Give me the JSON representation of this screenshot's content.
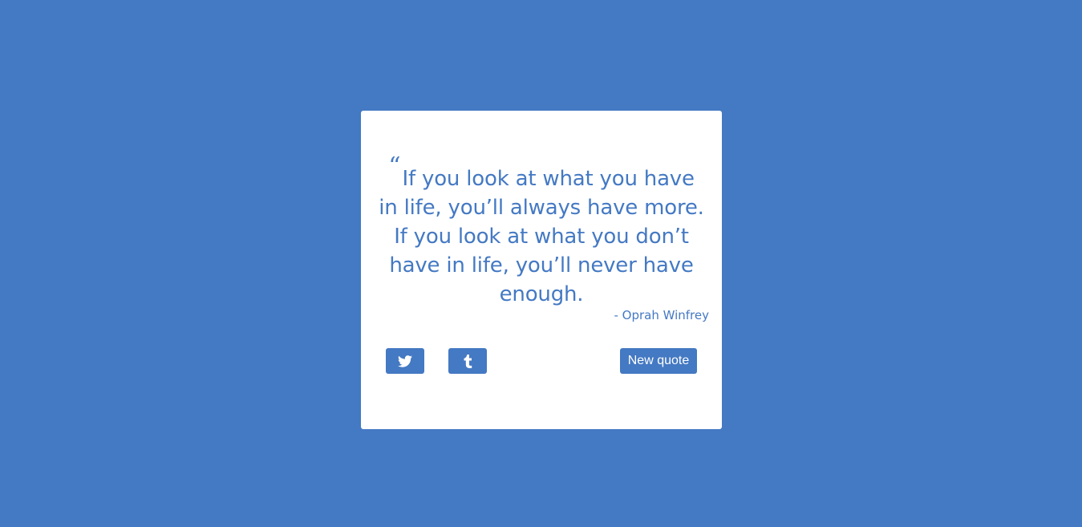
{
  "quote": {
    "mark": "“",
    "text": "If you look at what you have in life, you’ll always have more. If you look at what you don’t have in life, you’ll never have enough.",
    "author": "- Oprah Winfrey"
  },
  "actions": {
    "twitter_icon": "twitter-icon",
    "tumblr_icon": "tumblr-icon",
    "new_quote_label": "New quote"
  },
  "colors": {
    "background": "#4479c3",
    "card": "#ffffff",
    "accent": "#4479c3"
  }
}
